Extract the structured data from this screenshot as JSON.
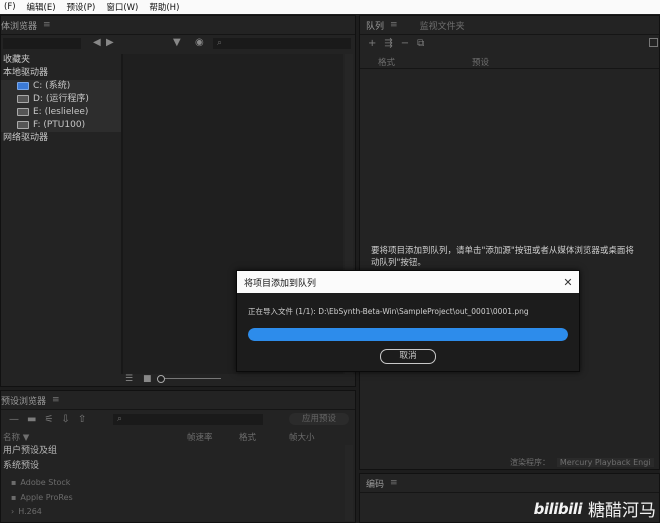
{
  "menubar": {
    "items": [
      "(F)",
      "编辑(E)",
      "预设(P)",
      "窗口(W)",
      "帮助(H)"
    ]
  },
  "media_browser": {
    "tab_label": "体浏览器",
    "tree": {
      "favorites": "收藏夹",
      "local_drives": "本地驱动器",
      "drives": [
        "C: (系统)",
        "D: (运行程序)",
        "E: (leslielee)",
        "F: (PTU100)"
      ],
      "network_drives": "网络驱动器"
    }
  },
  "preset_browser": {
    "tab_label": "预设浏览器",
    "apply_button": "应用预设",
    "columns": {
      "name": "名称 ▼",
      "frame_rate": "帧速率",
      "format": "格式",
      "size": "帧大小"
    },
    "rows": [
      "用户预设及组",
      "系统预设",
      "Adobe Stock",
      "Apple ProRes",
      "H.264"
    ]
  },
  "queue": {
    "tab_label": "队列",
    "watch_tab_label": "监视文件夹",
    "columns": {
      "format": "格式",
      "preset": "预设"
    },
    "hint_line1": "要将项目添加到队列，请单击\"添加源\"按钮或者从媒体浏览器或桌面将",
    "hint_line2": "动队列\"按钮。",
    "renderer_label": "渲染程序：",
    "renderer_value": "Mercury Playback Engi"
  },
  "encoding": {
    "tab_label": "编码"
  },
  "dialog": {
    "title": "将项目添加到队列",
    "close_glyph": "✕",
    "status_text": "正在导入文件 (1/1): D:\\EbSynth-Beta-Win\\SampleProject\\out_0001\\0001.png",
    "progress": 1.0,
    "cancel_label": "取消"
  },
  "watermark": {
    "logo": "bilibili",
    "text": "糖醋河马"
  },
  "colors": {
    "accent": "#2d8ceb",
    "panel": "#232323",
    "background": "#1d1d1d"
  }
}
